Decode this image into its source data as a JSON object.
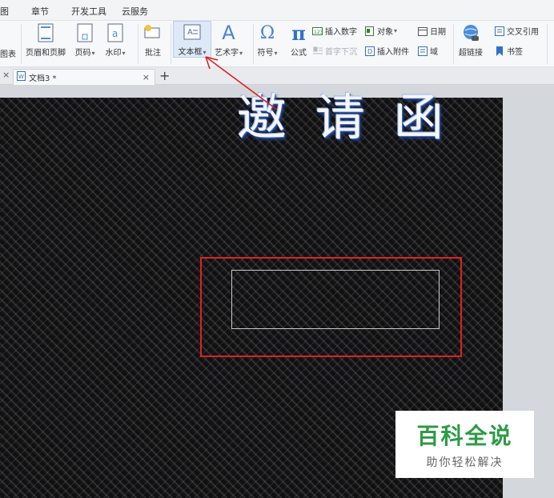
{
  "menu_tabs": [
    "图",
    "章节",
    "开发工具",
    "云服务"
  ],
  "ribbon": {
    "chart_partial": "图表",
    "header_footer": "页眉和页脚",
    "page_number": "页码",
    "watermark": "水印",
    "comment": "批注",
    "textbox": "文本框",
    "wordart": "艺术字",
    "symbol": "符号",
    "formula": "公式",
    "insert_number": "插入数字",
    "object": "对象",
    "date": "日期",
    "drop_cap": "首字下沉",
    "insert_attachment": "插入附件",
    "field": "域",
    "hyperlink": "超链接",
    "cross_ref": "交叉引用",
    "bookmark": "书签"
  },
  "document_tab": {
    "title": "文档3 *",
    "close": "×",
    "add": "+",
    "prev_close": "×"
  },
  "document": {
    "title_text": "邀请函"
  },
  "watermark": {
    "title": "百科全说",
    "subtitle": "助你轻松解决"
  },
  "colors": {
    "highlight_red": "#e02020",
    "watermark_green": "#2e9a46",
    "ribbon_active": "#dde9f7"
  }
}
